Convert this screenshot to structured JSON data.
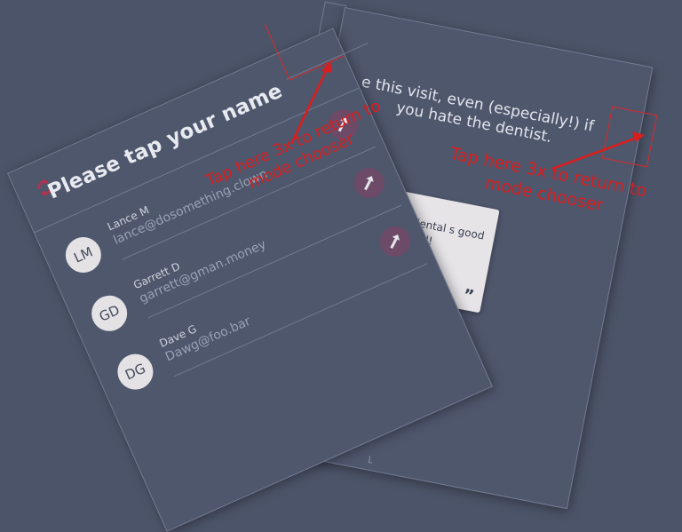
{
  "back_card": {
    "survey_text": "e this visit, even (especially!) if you hate the dentist.",
    "quote_text": "he dental s good as I ed!",
    "quote_mark": "”",
    "annotation": "Tap here 3x to return to mode chooser",
    "small_mark": "└"
  },
  "front_card": {
    "title": "Please tap your name",
    "annotation": "Tap here 3x to return to mode chooser",
    "people": [
      {
        "initials": "LM",
        "name": "Lance M",
        "email": "lance@dosomething.clown"
      },
      {
        "initials": "GD",
        "name": "Garrett D",
        "email": "garrett@gman.money"
      },
      {
        "initials": "DG",
        "name": "Dave G",
        "email": "Dawg@foo.bar"
      }
    ]
  },
  "colors": {
    "background": "#4c5469",
    "card": "#4f576d",
    "annotation_red": "#d81e1e",
    "button_purple": "#6d4a68"
  },
  "icons": {
    "refresh": "refresh-icon",
    "go": "arrow-right-icon"
  }
}
